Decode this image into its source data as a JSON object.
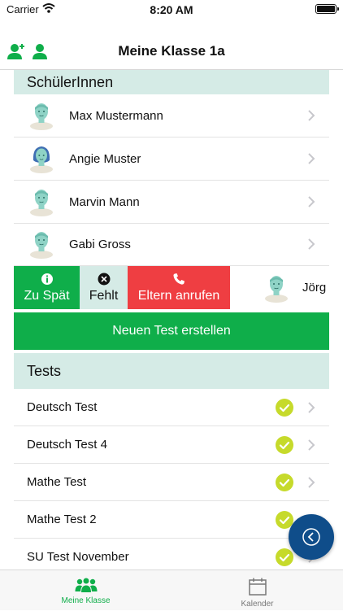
{
  "status_bar": {
    "carrier": "Carrier",
    "time": "8:20 AM"
  },
  "nav": {
    "title": "Meine Klasse 1a",
    "icons": [
      "add-student-icon",
      "student-icon"
    ]
  },
  "students_section": {
    "title": "SchülerInnen"
  },
  "students": [
    {
      "name": "Max Mustermann",
      "avatar": "male-student-avatar"
    },
    {
      "name": "Angie Muster",
      "avatar": "female-student-avatar"
    },
    {
      "name": "Marvin Mann",
      "avatar": "male-student-avatar"
    },
    {
      "name": "Gabi Gross",
      "avatar": "male-student-avatar"
    }
  ],
  "swipe_row": {
    "student_name": "Jörg",
    "actions": [
      {
        "label": "Zu Spät",
        "icon": "info-icon"
      },
      {
        "label": "Fehlt",
        "icon": "x-circle-icon"
      },
      {
        "label": "Eltern anrufen",
        "icon": "phone-icon"
      }
    ]
  },
  "create_test_label": "Neuen Test erstellen",
  "tests_section": {
    "title": "Tests"
  },
  "tests": [
    {
      "name": "Deutsch Test",
      "status": "check-icon"
    },
    {
      "name": "Deutsch Test 4",
      "status": "check-icon"
    },
    {
      "name": "Mathe Test",
      "status": "check-icon"
    },
    {
      "name": "Mathe Test 2",
      "status": "check-icon"
    },
    {
      "name": "SU Test November",
      "status": "check-icon"
    }
  ],
  "tabs": [
    {
      "label": "Meine Klasse",
      "icon": "class-icon",
      "active": true
    },
    {
      "label": "Kalender",
      "icon": "calendar-icon",
      "active": false
    }
  ],
  "colors": {
    "green": "#0fae4a",
    "header_bg": "#d5ebe6",
    "red": "#ef3e42",
    "check": "#c6da2b",
    "fab": "#0f4d8a"
  }
}
